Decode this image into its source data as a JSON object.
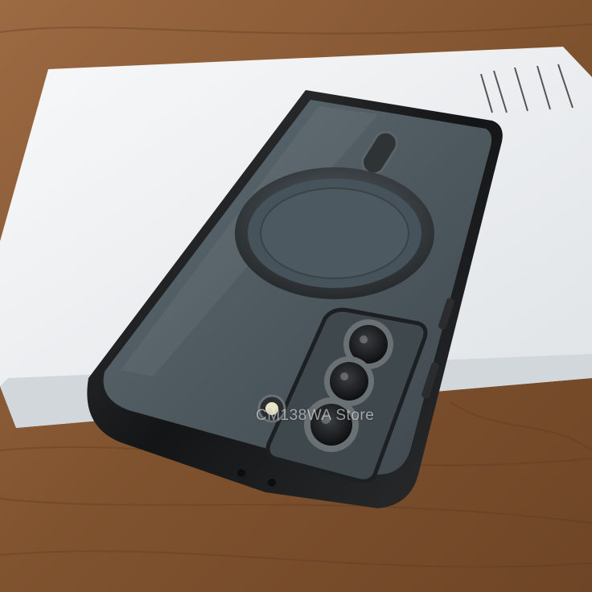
{
  "watermark": "CM138WA Store",
  "colors": {
    "wood": "#8a5a36",
    "wood_dark": "#5c3a20",
    "paper": "#f1f3f5",
    "case_frame": "#1c1e20",
    "phone_back": "#4f5b62",
    "ring": "#2f3336",
    "lens": "#1a1c1e"
  }
}
